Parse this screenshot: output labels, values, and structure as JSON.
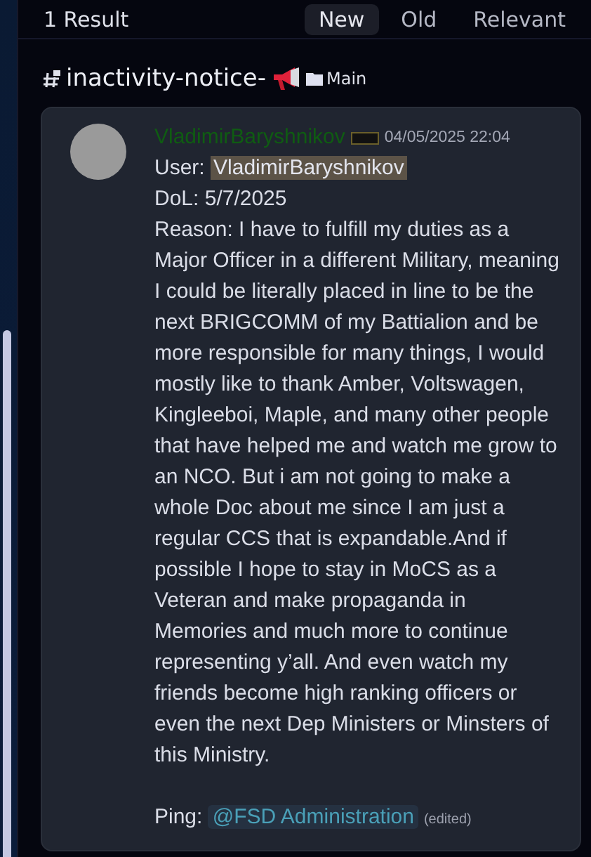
{
  "header": {
    "result_count": "1 Result",
    "sort_tabs": [
      {
        "label": "New",
        "selected": true
      },
      {
        "label": "Old",
        "selected": false
      },
      {
        "label": "Relevant",
        "selected": false
      }
    ]
  },
  "channel": {
    "name": "inactivity-notice-",
    "category": "Main"
  },
  "message": {
    "author": "VladimirBaryshnikov",
    "timestamp": "04/05/2025 22:04",
    "lines": [
      {
        "kind": "mention",
        "label": "User: ",
        "value": "VladimirBaryshnikov"
      },
      {
        "kind": "text",
        "value": "DoL: 5/7/2025"
      },
      {
        "kind": "text",
        "value": "Reason: I have to fulfill my duties as a Major Officer in a different Military, meaning I could be literally placed in line to be the next BRIGCOMM of my Battialion and be more responsible for many things, I would mostly like to thank Amber, Voltswagen, Kingleeboi, Maple, and many other people that have helped me and watch me grow to an NCO. But i am not going to make a whole Doc about me since I am just a regular CCS that is expandable.And if possible I hope to stay in MoCS as a Veteran and make propaganda in Memories and much more to continue representing y’all. And even watch my friends become high ranking officers or even the next Dep Ministers or Minsters of this Ministry."
      },
      {
        "kind": "blank"
      },
      {
        "kind": "role",
        "label": "Ping: ",
        "value": "@FSD Administration",
        "edited": "(edited)"
      }
    ]
  }
}
